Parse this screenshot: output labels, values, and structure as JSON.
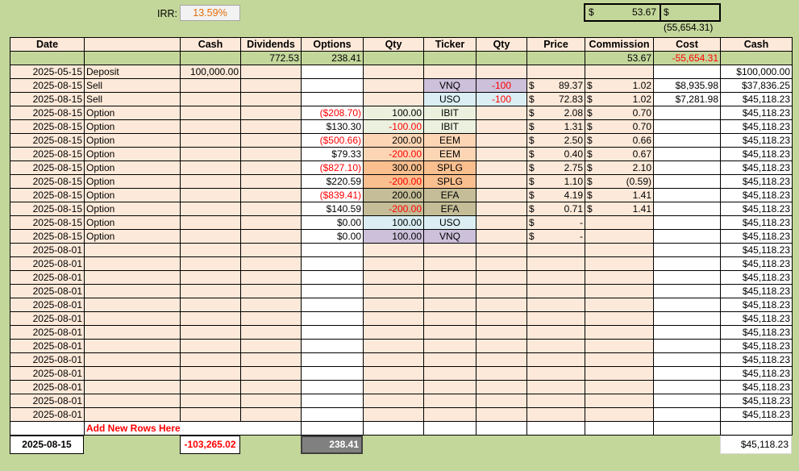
{
  "irr": {
    "label": "IRR:",
    "value": "13.59%"
  },
  "summary": {
    "dollar": "$",
    "commission_total": "53.67",
    "cost_total": "$ (55,654.31)"
  },
  "headers": [
    "Date",
    "",
    "Cash",
    "Dividends",
    "Options",
    "Qty",
    "Ticker",
    "Qty",
    "Price",
    "Commission",
    "Cost",
    "Cash"
  ],
  "totals": {
    "dividends": "772.53",
    "options": "238.41",
    "commission": "53.67",
    "cost": "-55,654.31"
  },
  "rows": [
    {
      "date": "2025-05-15",
      "type": "Deposit",
      "cash": "100,000.00",
      "options": "",
      "opt_neg": false,
      "qty": "",
      "qty_neg": false,
      "ticker": "",
      "tclass": "",
      "qty2": "",
      "price_sym": "",
      "price": "",
      "comm_sym": "",
      "comm": "",
      "cost": "",
      "balance": "$100,000.00"
    },
    {
      "date": "2025-08-15",
      "type": "Sell",
      "cash": "",
      "options": "",
      "opt_neg": false,
      "qty": "",
      "qty_neg": false,
      "ticker": "VNQ",
      "tclass": "t-vnq",
      "qty2": "-100",
      "price_sym": "$",
      "price": "89.37",
      "comm_sym": "$",
      "comm": "1.02",
      "cost": "$8,935.98",
      "balance": "$37,836.25"
    },
    {
      "date": "2025-08-15",
      "type": "Sell",
      "cash": "",
      "options": "",
      "opt_neg": false,
      "qty": "",
      "qty_neg": false,
      "ticker": "USO",
      "tclass": "t-uso",
      "qty2": "-100",
      "price_sym": "$",
      "price": "72.83",
      "comm_sym": "$",
      "comm": "1.02",
      "cost": "$7,281.98",
      "balance": "$45,118.23"
    },
    {
      "date": "2025-08-15",
      "type": "Option",
      "cash": "",
      "options": "($208.70)",
      "opt_neg": true,
      "qty": "100.00",
      "qty_neg": false,
      "ticker": "IBIT",
      "tclass": "t-ibit",
      "qty2": "",
      "price_sym": "$",
      "price": "2.08",
      "comm_sym": "$",
      "comm": "0.70",
      "cost": "",
      "balance": "$45,118.23"
    },
    {
      "date": "2025-08-15",
      "type": "Option",
      "cash": "",
      "options": "$130.30",
      "opt_neg": false,
      "qty": "-100.00",
      "qty_neg": true,
      "ticker": "IBIT",
      "tclass": "t-ibit",
      "qty2": "",
      "price_sym": "$",
      "price": "1.31",
      "comm_sym": "$",
      "comm": "0.70",
      "cost": "",
      "balance": "$45,118.23"
    },
    {
      "date": "2025-08-15",
      "type": "Option",
      "cash": "",
      "options": "($500.66)",
      "opt_neg": true,
      "qty": "200.00",
      "qty_neg": false,
      "ticker": "EEM",
      "tclass": "t-eem",
      "qty2": "",
      "price_sym": "$",
      "price": "2.50",
      "comm_sym": "$",
      "comm": "0.66",
      "cost": "",
      "balance": "$45,118.23"
    },
    {
      "date": "2025-08-15",
      "type": "Option",
      "cash": "",
      "options": "$79.33",
      "opt_neg": false,
      "qty": "-200.00",
      "qty_neg": true,
      "ticker": "EEM",
      "tclass": "t-eem",
      "qty2": "",
      "price_sym": "$",
      "price": "0.40",
      "comm_sym": "$",
      "comm": "0.67",
      "cost": "",
      "balance": "$45,118.23"
    },
    {
      "date": "2025-08-15",
      "type": "Option",
      "cash": "",
      "options": "($827.10)",
      "opt_neg": true,
      "qty": "300.00",
      "qty_neg": false,
      "ticker": "SPLG",
      "tclass": "t-splg",
      "qty2": "",
      "price_sym": "$",
      "price": "2.75",
      "comm_sym": "$",
      "comm": "2.10",
      "cost": "",
      "balance": "$45,118.23"
    },
    {
      "date": "2025-08-15",
      "type": "Option",
      "cash": "",
      "options": "$220.59",
      "opt_neg": false,
      "qty": "-200.00",
      "qty_neg": true,
      "ticker": "SPLG",
      "tclass": "t-splg",
      "qty2": "",
      "price_sym": "$",
      "price": "1.10",
      "comm_sym": "$",
      "comm": "(0.59)",
      "cost": "",
      "balance": "$45,118.23"
    },
    {
      "date": "2025-08-15",
      "type": "Option",
      "cash": "",
      "options": "($839.41)",
      "opt_neg": true,
      "qty": "200.00",
      "qty_neg": false,
      "ticker": "EFA",
      "tclass": "t-efa",
      "qty2": "",
      "price_sym": "$",
      "price": "4.19",
      "comm_sym": "$",
      "comm": "1.41",
      "cost": "",
      "balance": "$45,118.23"
    },
    {
      "date": "2025-08-15",
      "type": "Option",
      "cash": "",
      "options": "$140.59",
      "opt_neg": false,
      "qty": "-200.00",
      "qty_neg": true,
      "ticker": "EFA",
      "tclass": "t-efa",
      "qty2": "",
      "price_sym": "$",
      "price": "0.71",
      "comm_sym": "$",
      "comm": "1.41",
      "cost": "",
      "balance": "$45,118.23"
    },
    {
      "date": "2025-08-15",
      "type": "Option",
      "cash": "",
      "options": "$0.00",
      "opt_neg": false,
      "qty": "100.00",
      "qty_neg": false,
      "ticker": "USO",
      "tclass": "t-uso",
      "qty2": "",
      "price_sym": "$",
      "price": "-",
      "comm_sym": "",
      "comm": "",
      "cost": "",
      "balance": "$45,118.23"
    },
    {
      "date": "2025-08-15",
      "type": "Option",
      "cash": "",
      "options": "$0.00",
      "opt_neg": false,
      "qty": "100.00",
      "qty_neg": false,
      "ticker": "VNQ",
      "tclass": "t-vnq",
      "qty2": "",
      "price_sym": "$",
      "price": "-",
      "comm_sym": "",
      "comm": "",
      "cost": "",
      "balance": "$45,118.23"
    },
    {
      "date": "2025-08-01",
      "type": "",
      "cash": "",
      "options": "",
      "opt_neg": false,
      "qty": "",
      "qty_neg": false,
      "ticker": "",
      "tclass": "",
      "qty2": "",
      "price_sym": "",
      "price": "",
      "comm_sym": "",
      "comm": "",
      "cost": "",
      "balance": "$45,118.23"
    },
    {
      "date": "2025-08-01",
      "type": "",
      "cash": "",
      "options": "",
      "opt_neg": false,
      "qty": "",
      "qty_neg": false,
      "ticker": "",
      "tclass": "",
      "qty2": "",
      "price_sym": "",
      "price": "",
      "comm_sym": "",
      "comm": "",
      "cost": "",
      "balance": "$45,118.23"
    },
    {
      "date": "2025-08-01",
      "type": "",
      "cash": "",
      "options": "",
      "opt_neg": false,
      "qty": "",
      "qty_neg": false,
      "ticker": "",
      "tclass": "",
      "qty2": "",
      "price_sym": "",
      "price": "",
      "comm_sym": "",
      "comm": "",
      "cost": "",
      "balance": "$45,118.23"
    },
    {
      "date": "2025-08-01",
      "type": "",
      "cash": "",
      "options": "",
      "opt_neg": false,
      "qty": "",
      "qty_neg": false,
      "ticker": "",
      "tclass": "",
      "qty2": "",
      "price_sym": "",
      "price": "",
      "comm_sym": "",
      "comm": "",
      "cost": "",
      "balance": "$45,118.23"
    },
    {
      "date": "2025-08-01",
      "type": "",
      "cash": "",
      "options": "",
      "opt_neg": false,
      "qty": "",
      "qty_neg": false,
      "ticker": "",
      "tclass": "",
      "qty2": "",
      "price_sym": "",
      "price": "",
      "comm_sym": "",
      "comm": "",
      "cost": "",
      "balance": "$45,118.23"
    },
    {
      "date": "2025-08-01",
      "type": "",
      "cash": "",
      "options": "",
      "opt_neg": false,
      "qty": "",
      "qty_neg": false,
      "ticker": "",
      "tclass": "",
      "qty2": "",
      "price_sym": "",
      "price": "",
      "comm_sym": "",
      "comm": "",
      "cost": "",
      "balance": "$45,118.23"
    },
    {
      "date": "2025-08-01",
      "type": "",
      "cash": "",
      "options": "",
      "opt_neg": false,
      "qty": "",
      "qty_neg": false,
      "ticker": "",
      "tclass": "",
      "qty2": "",
      "price_sym": "",
      "price": "",
      "comm_sym": "",
      "comm": "",
      "cost": "",
      "balance": "$45,118.23"
    },
    {
      "date": "2025-08-01",
      "type": "",
      "cash": "",
      "options": "",
      "opt_neg": false,
      "qty": "",
      "qty_neg": false,
      "ticker": "",
      "tclass": "",
      "qty2": "",
      "price_sym": "",
      "price": "",
      "comm_sym": "",
      "comm": "",
      "cost": "",
      "balance": "$45,118.23"
    },
    {
      "date": "2025-08-01",
      "type": "",
      "cash": "",
      "options": "",
      "opt_neg": false,
      "qty": "",
      "qty_neg": false,
      "ticker": "",
      "tclass": "",
      "qty2": "",
      "price_sym": "",
      "price": "",
      "comm_sym": "",
      "comm": "",
      "cost": "",
      "balance": "$45,118.23"
    },
    {
      "date": "2025-08-01",
      "type": "",
      "cash": "",
      "options": "",
      "opt_neg": false,
      "qty": "",
      "qty_neg": false,
      "ticker": "",
      "tclass": "",
      "qty2": "",
      "price_sym": "",
      "price": "",
      "comm_sym": "",
      "comm": "",
      "cost": "",
      "balance": "$45,118.23"
    },
    {
      "date": "2025-08-01",
      "type": "",
      "cash": "",
      "options": "",
      "opt_neg": false,
      "qty": "",
      "qty_neg": false,
      "ticker": "",
      "tclass": "",
      "qty2": "",
      "price_sym": "",
      "price": "",
      "comm_sym": "",
      "comm": "",
      "cost": "",
      "balance": "$45,118.23"
    },
    {
      "date": "2025-08-01",
      "type": "",
      "cash": "",
      "options": "",
      "opt_neg": false,
      "qty": "",
      "qty_neg": false,
      "ticker": "",
      "tclass": "",
      "qty2": "",
      "price_sym": "",
      "price": "",
      "comm_sym": "",
      "comm": "",
      "cost": "",
      "balance": "$45,118.23"
    },
    {
      "date": "2025-08-01",
      "type": "",
      "cash": "",
      "options": "",
      "opt_neg": false,
      "qty": "",
      "qty_neg": false,
      "ticker": "",
      "tclass": "",
      "qty2": "",
      "price_sym": "",
      "price": "",
      "comm_sym": "",
      "comm": "",
      "cost": "",
      "balance": "$45,118.23"
    }
  ],
  "add_rows_label": "Add New Rows Here",
  "footer": {
    "date": "2025-08-15",
    "cash": "-103,265.02",
    "options": "238.41",
    "balance": "$45,118.23"
  },
  "colors": {
    "background": "#c4d79b",
    "peach": "#fde9d9",
    "negative": "#ff0000",
    "irr": "#e46c0a"
  }
}
